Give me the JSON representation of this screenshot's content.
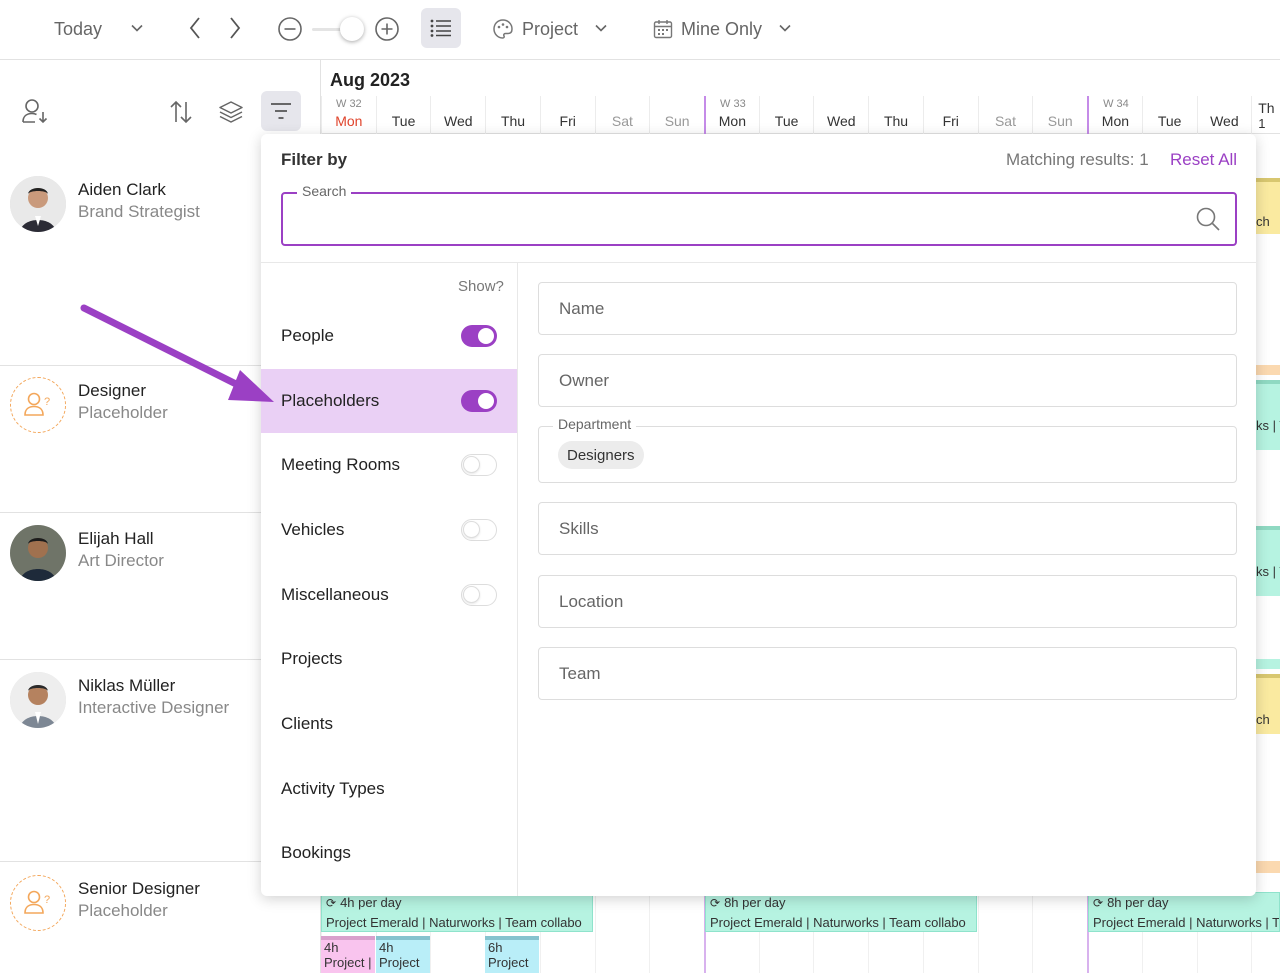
{
  "toolbar": {
    "today_label": "Today",
    "project_label": "Project",
    "mine_only_label": "Mine Only"
  },
  "calendar": {
    "month": "Aug 2023",
    "week_labels": [
      "W 32",
      "W 33",
      "W 34"
    ],
    "days": [
      "Mon",
      "Tue",
      "Wed",
      "Thu",
      "Fri",
      "Sat",
      "Sun",
      "Mon",
      "Tue",
      "Wed",
      "Thu",
      "Fri",
      "Sat",
      "Sun",
      "Mon",
      "Tue",
      "Wed",
      "Th"
    ],
    "partial_day_number": "1"
  },
  "people": [
    {
      "name": "Aiden Clark",
      "role": "Brand Strategist"
    },
    {
      "name": "Designer",
      "role": "Placeholder"
    },
    {
      "name": "Elijah Hall",
      "role": "Art Director"
    },
    {
      "name": "Niklas Müller",
      "role": "Interactive Designer"
    },
    {
      "name": "Senior Designer",
      "role": "Placeholder"
    }
  ],
  "bookings": {
    "b1_hours": "4h per day",
    "b2_hours": "8h per day",
    "b3_hours": "8h per day",
    "project_text": "Project Emerald | Naturworks | Team collabo",
    "project_text_short": "Project Emerald | Naturworks | T",
    "mini1_hours": "4h",
    "mini2_hours": "4h",
    "mini3_hours": "6h",
    "mini1_text": "Project | E",
    "mini2_text": "Project",
    "mini3_text": "Project",
    "stub_ch": "ch",
    "stub_ks": "ks | T"
  },
  "filter": {
    "title": "Filter by",
    "matching": "Matching results: 1",
    "reset": "Reset All",
    "search_legend": "Search",
    "search_value": "",
    "show_label": "Show?",
    "categories": [
      {
        "label": "People",
        "toggle": "on"
      },
      {
        "label": "Placeholders",
        "toggle": "on"
      },
      {
        "label": "Meeting Rooms",
        "toggle": "off"
      },
      {
        "label": "Vehicles",
        "toggle": "off"
      },
      {
        "label": "Miscellaneous",
        "toggle": "off"
      },
      {
        "label": "Projects"
      },
      {
        "label": "Clients"
      },
      {
        "label": "Activity Types"
      },
      {
        "label": "Bookings"
      }
    ],
    "fields": {
      "name": "Name",
      "owner": "Owner",
      "department_legend": "Department",
      "department_chip": "Designers",
      "skills": "Skills",
      "location": "Location",
      "team": "Team"
    }
  },
  "colors": {
    "accent": "#9b40c4",
    "active_row": "#ead0f5",
    "booking": "#b6f3e1",
    "arrow": "#9b40c4",
    "placeholder_ring": "#f3a75b",
    "today_red": "#e0442c"
  }
}
